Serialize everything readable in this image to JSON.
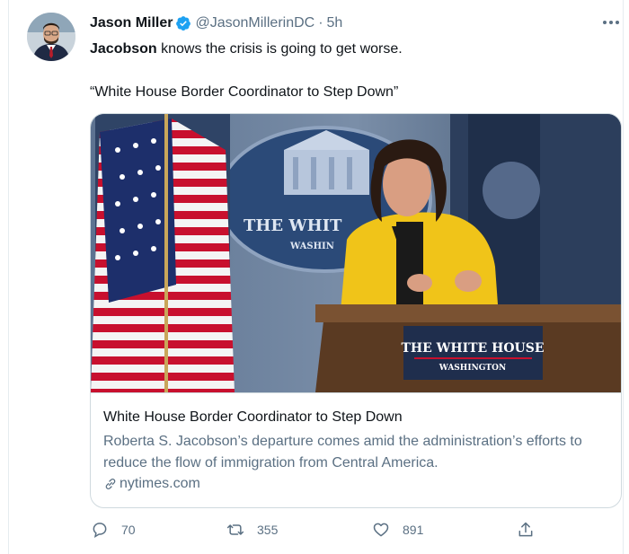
{
  "tweet": {
    "author_name": "Jason Miller",
    "handle": "@JasonMillerinDC",
    "separator": "·",
    "time": "5h",
    "text_bold": "Jacobson",
    "text_rest": " knows the crisis is going to get worse.",
    "quote_line": "“White House Border Coordinator to Step Down”"
  },
  "card": {
    "image_sign_text": "THE WHITE HOUSE",
    "image_sign_subtext": "WASHINGTON",
    "image_seal_text": "THE WHIT",
    "image_seal_subtext": "WASHIN",
    "title": "White House Border Coordinator to Step Down",
    "description": "Roberta S. Jacobson’s departure comes amid the administration’s efforts to reduce the flow of immigration from Central America.",
    "domain": "nytimes.com"
  },
  "actions": {
    "replies": "70",
    "retweets": "355",
    "likes": "891"
  },
  "colors": {
    "verified": "#1da1f2",
    "secondary_text": "#5b7083",
    "jacket": "#f0c419"
  },
  "icons": [
    "verified-icon",
    "more-icon",
    "link-icon",
    "reply-icon",
    "retweet-icon",
    "like-icon",
    "share-icon"
  ]
}
